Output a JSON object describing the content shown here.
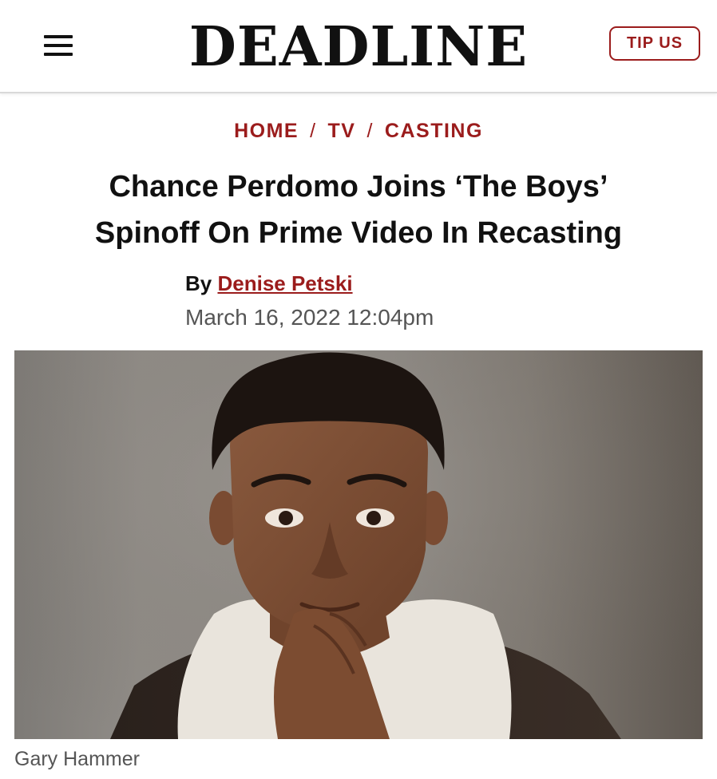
{
  "header": {
    "logo": "DEADLINE",
    "tip_label": "TIP US",
    "menu_icon": "hamburger-menu-icon"
  },
  "breadcrumb": {
    "items": [
      "HOME",
      "TV",
      "CASTING"
    ],
    "separator": "/"
  },
  "article": {
    "headline_line1": "Chance Perdomo Joins ‘The Boys’",
    "headline_line2": "Spinoff On Prime Video In Recasting",
    "byline_prefix": "By",
    "author": "Denise Petski",
    "date": "March 16, 2022 12:04pm",
    "image_credit": "Gary Hammer"
  },
  "colors": {
    "accent": "#9b1c1c",
    "text": "#111111",
    "meta": "#555555"
  }
}
